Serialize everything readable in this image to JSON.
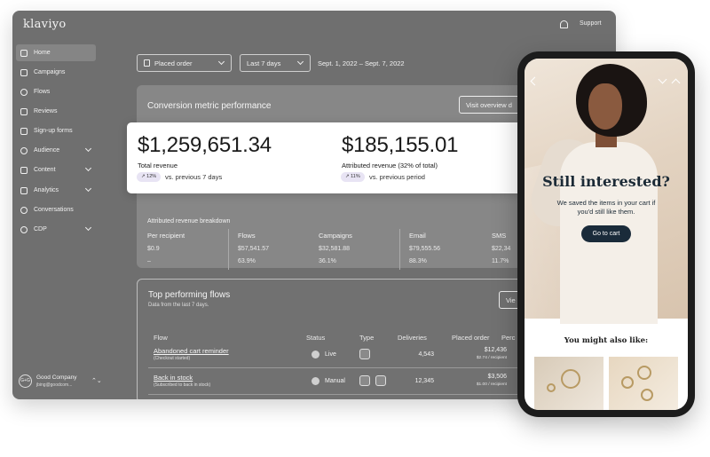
{
  "app": {
    "logo": "klaviyo",
    "support_label": "Support"
  },
  "sidebar": {
    "items": [
      {
        "label": "Home",
        "icon": "home-icon"
      },
      {
        "label": "Campaigns",
        "icon": "send-icon"
      },
      {
        "label": "Flows",
        "icon": "flows-icon"
      },
      {
        "label": "Reviews",
        "icon": "star-icon"
      },
      {
        "label": "Sign-up forms",
        "icon": "form-icon"
      },
      {
        "label": "Audience",
        "icon": "people-icon"
      },
      {
        "label": "Content",
        "icon": "folder-icon"
      },
      {
        "label": "Analytics",
        "icon": "chart-icon"
      },
      {
        "label": "Conversations",
        "icon": "chat-icon"
      },
      {
        "label": "CDP",
        "icon": "cloud-icon"
      }
    ],
    "account": {
      "avatar": "G+G",
      "name": "Good Company",
      "email": "jbing@goodcom...",
      "toggle": "⌃⌄"
    }
  },
  "filters": {
    "metric": "Placed order",
    "period": "Last 7 days",
    "date_range": "Sept. 1, 2022 – Sept. 7, 2022"
  },
  "conversion": {
    "title": "Conversion metric performance",
    "visit_button": "Visit overview d",
    "total_revenue": "$1,259,651.34",
    "total_revenue_label": "Total revenue",
    "total_change": "↗ 12%",
    "total_vs": "vs. previous 7 days",
    "attributed_revenue": "$185,155.01",
    "attributed_label": "Attributed revenue (32% of total)",
    "attributed_change": "↗ 11%",
    "attributed_vs": "vs. previous period",
    "breakdown_title": "Attributed revenue breakdown",
    "breakdown": [
      {
        "label": "Per recipient",
        "value": "$0.9",
        "share": "–"
      },
      {
        "label": "Flows",
        "value": "$57,541.57",
        "share": "63.9%"
      },
      {
        "label": "Campaigns",
        "value": "$32,581.88",
        "share": "36.1%"
      },
      {
        "label": "Email",
        "value": "$79,555.56",
        "share": "88.3%"
      },
      {
        "label": "SMS",
        "value": "$22,34",
        "share": "11.7%"
      }
    ]
  },
  "flows": {
    "title": "Top performing flows",
    "subtitle": "Data from the last 7 days.",
    "view_button": "Vie",
    "headers": {
      "flow": "Flow",
      "status": "Status",
      "type": "Type",
      "deliveries": "Deliveries",
      "placed": "Placed order",
      "percent": "Perc"
    },
    "rows": [
      {
        "name": "Abandoned cart reminder",
        "sub": "(Checkout started)",
        "status": "Live",
        "deliveries": "4,543",
        "placed": "$12,436",
        "per": "$2.74 / recipient"
      },
      {
        "name": "Back in stock",
        "sub": "(Subscribed to back in stock)",
        "status": "Manual",
        "deliveries": "12,345",
        "placed": "$3,506",
        "per": "$1.00 / recipient"
      }
    ]
  },
  "phone": {
    "headline": "Still interested?",
    "subline": "We saved the items in your cart if you'd still like them.",
    "cta": "Go to cart",
    "also_like": "You might also like:"
  }
}
